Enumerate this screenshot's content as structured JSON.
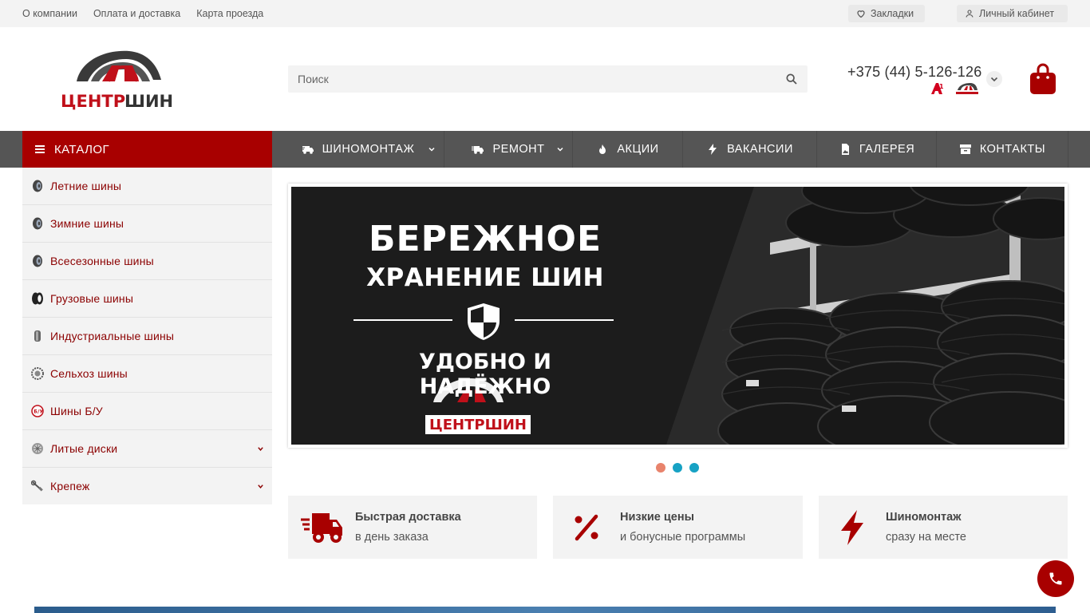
{
  "topbar": {
    "links": [
      "О компании",
      "Оплата и доставка",
      "Карта проезда"
    ],
    "bookmarks_label": "Закладки",
    "account_label": "Личный кабинет"
  },
  "header": {
    "logo_text": "ЦЕНТРШИН",
    "search_placeholder": "Поиск",
    "phone": "+375 (44) 5-126-126",
    "operator_label": "A1"
  },
  "nav": {
    "catalog_label": "КАТАЛОГ",
    "items": [
      {
        "label": "ШИНОМОНТАЖ",
        "icon": "truck-icon"
      },
      {
        "label": "РЕМОНТ",
        "icon": "tow-truck-icon"
      },
      {
        "label": "АКЦИИ",
        "icon": "fire-icon"
      },
      {
        "label": "ВАКАНСИИ",
        "icon": "bolt-icon"
      },
      {
        "label": "ГАЛЕРЕЯ",
        "icon": "file-image-icon"
      },
      {
        "label": "КОНТАКТЫ",
        "icon": "box-icon"
      }
    ]
  },
  "sidebar": {
    "items": [
      {
        "label": "Летние шины",
        "icon": "tire-icon"
      },
      {
        "label": "Зимние шины",
        "icon": "tire-icon"
      },
      {
        "label": "Всесезонные шины",
        "icon": "tire-icon"
      },
      {
        "label": "Грузовые шины",
        "icon": "truck-tire-icon"
      },
      {
        "label": "Индустриальные шины",
        "icon": "industrial-tire-icon"
      },
      {
        "label": "Сельхоз шины",
        "icon": "agro-tire-icon"
      },
      {
        "label": "Шины Б/У",
        "icon": "used-tire-icon"
      },
      {
        "label": "Литые диски",
        "icon": "rim-icon"
      },
      {
        "label": "Крепеж",
        "icon": "wrench-icon"
      }
    ]
  },
  "banner": {
    "line1": "БЕРЕЖНОЕ",
    "line2": "ХРАНЕНИЕ ШИН",
    "line3": "УДОБНО И НАДЁЖНО",
    "logo_text": "ЦЕНТРШИН"
  },
  "slider": {
    "dot_colors": [
      "#e8836c",
      "#17a2c4",
      "#17a2c4"
    ]
  },
  "features": [
    {
      "title": "Быстрая доставка",
      "subtitle": "в день заказа",
      "icon": "delivery-truck-icon"
    },
    {
      "title": "Низкие цены",
      "subtitle": "и бонусные программы",
      "icon": "percent-icon"
    },
    {
      "title": "Шиномонтаж",
      "subtitle": "сразу на месте",
      "icon": "bolt-icon"
    }
  ],
  "colors": {
    "brand_red": "#a80000",
    "nav_gray": "#555555",
    "sidebar_bg": "#f3f3f3"
  }
}
